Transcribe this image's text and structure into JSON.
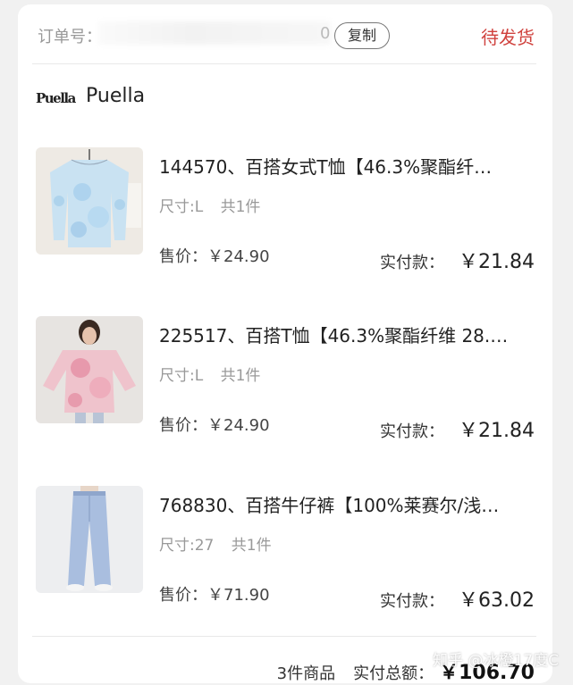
{
  "order": {
    "label": "订单号：",
    "number_tail": "0",
    "copy_label": "复制",
    "status": "待发货"
  },
  "shop": {
    "logo_text": "Puella",
    "name": "Puella"
  },
  "items": [
    {
      "title": "144570、百搭女式T恤【46.3%聚酯纤…",
      "size": "尺寸:L",
      "qty": "共1件",
      "price_label": "售价：",
      "price": "￥24.90",
      "paid_label": "实付款：",
      "paid": "￥21.84",
      "image_colors": [
        "#d9ecf6",
        "#9fcbe6"
      ]
    },
    {
      "title": "225517、百搭T恤【46.3%聚酯纤维 28.…",
      "size": "尺寸:L",
      "qty": "共1件",
      "price_label": "售价：",
      "price": "￥24.90",
      "paid_label": "实付款：",
      "paid": "￥21.84",
      "image_colors": [
        "#f4dde2",
        "#e79cab"
      ]
    },
    {
      "title": "768830、百搭牛仔裤【100%莱赛尔/浅…",
      "size": "尺寸:27",
      "qty": "共1件",
      "price_label": "售价：",
      "price": "￥71.90",
      "paid_label": "实付款：",
      "paid": "￥63.02",
      "image_colors": [
        "#e6ebf2",
        "#9fb6d9"
      ]
    }
  ],
  "footer": {
    "count": "3件商品",
    "total_label": "实付总额：",
    "total": "￥106.70"
  },
  "watermark": "知乎 @冰橙17度C"
}
